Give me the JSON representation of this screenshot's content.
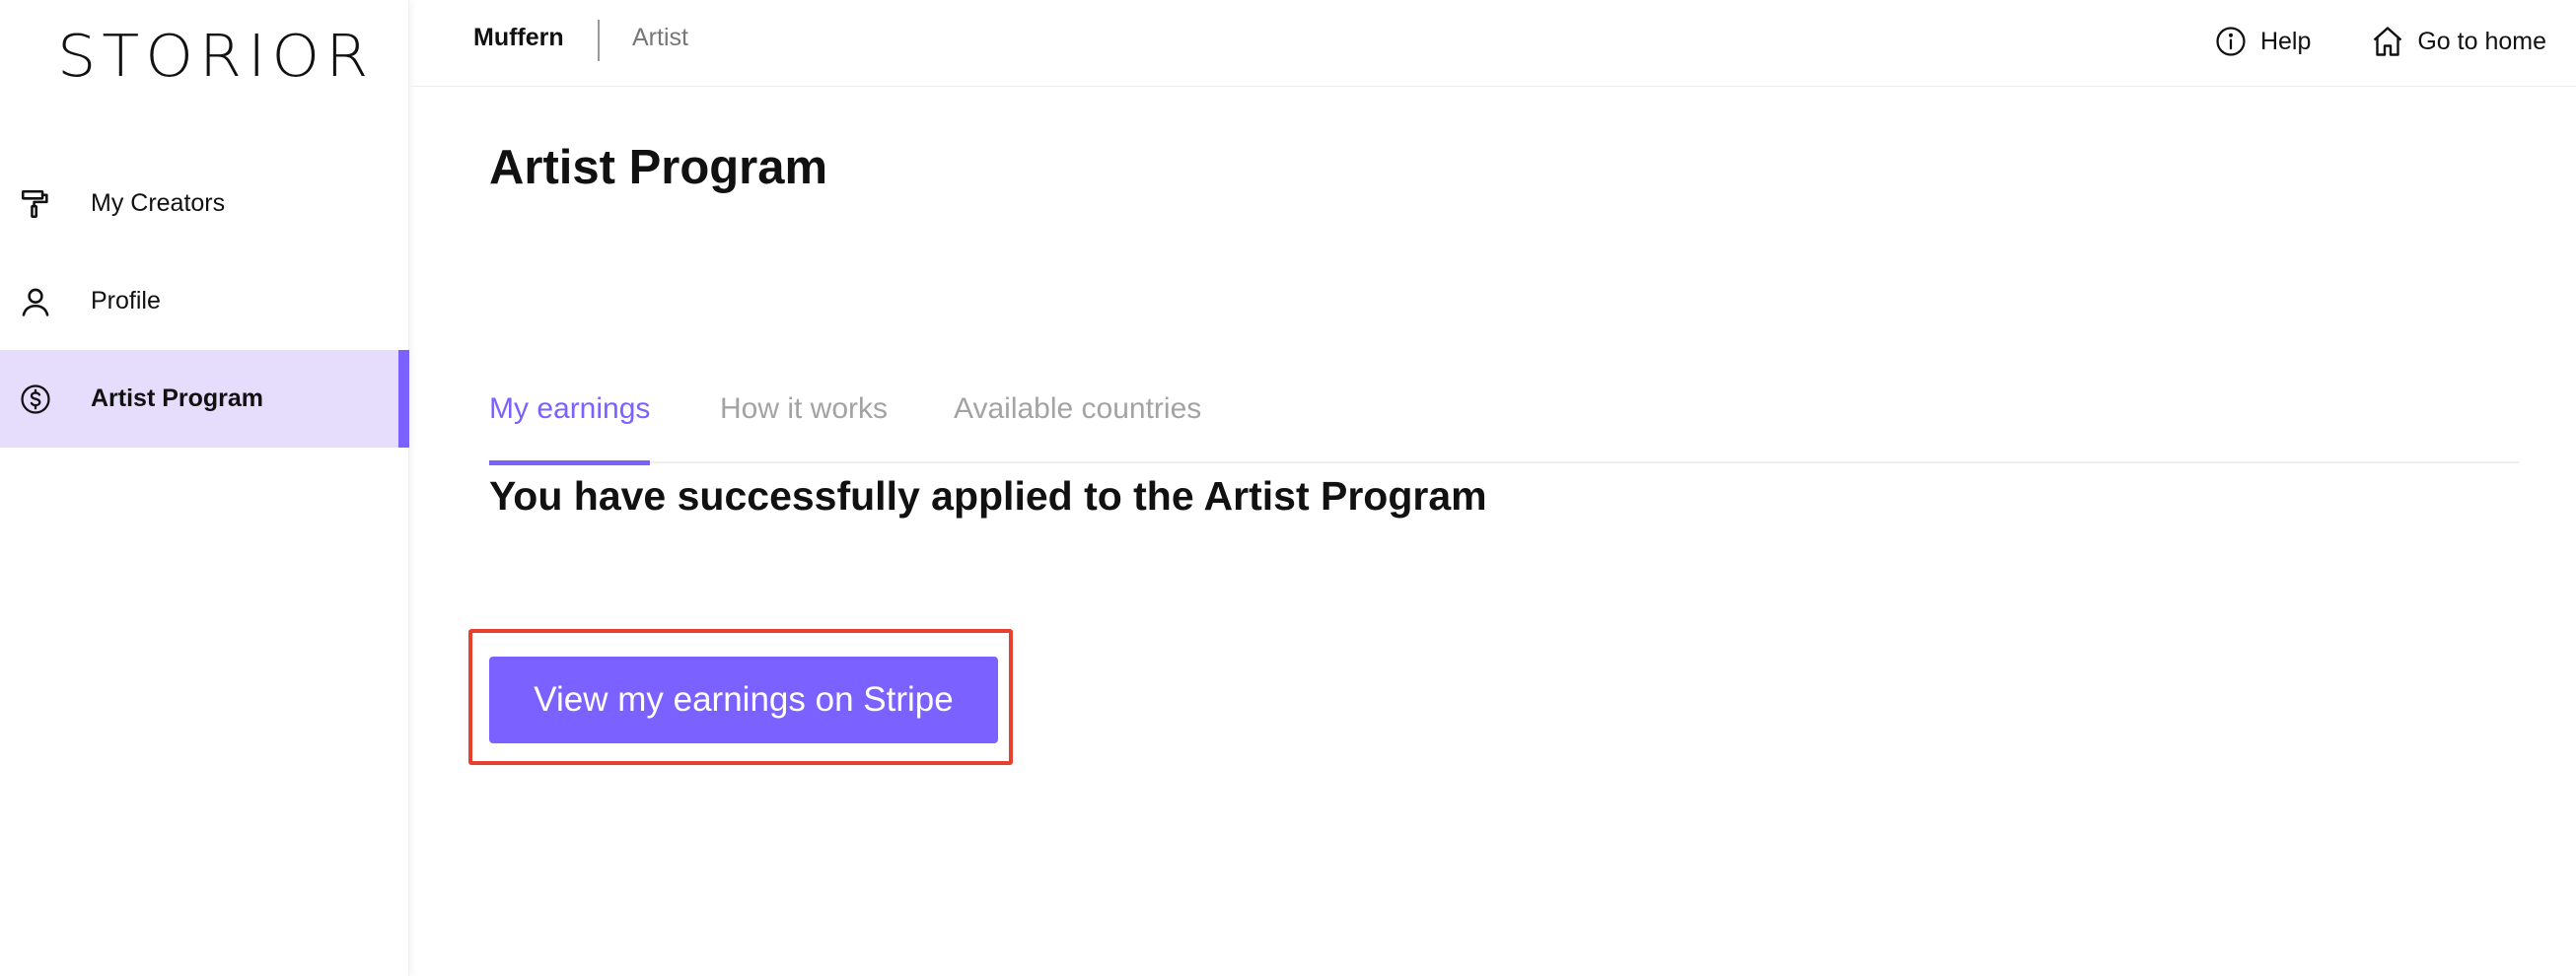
{
  "brand": {
    "logo_text": "STORIOR"
  },
  "sidebar": {
    "items": [
      {
        "label": "My Creators",
        "icon": "paint-roller-icon",
        "active": false
      },
      {
        "label": "Profile",
        "icon": "user-icon",
        "active": false
      },
      {
        "label": "Artist Program",
        "icon": "dollar-circle-icon",
        "active": true
      }
    ]
  },
  "header": {
    "primary": "Muffern",
    "secondary": "Artist",
    "help_label": "Help",
    "home_label": "Go to home"
  },
  "main": {
    "title": "Artist Program",
    "tabs": [
      {
        "label": "My earnings",
        "active": true
      },
      {
        "label": "How it works",
        "active": false
      },
      {
        "label": "Available countries",
        "active": false
      }
    ],
    "message": "You have successfully applied to the Artist Program",
    "cta_label": "View my earnings on Stripe"
  },
  "colors": {
    "accent": "#7b61ff",
    "active_bg": "#e6dcfb",
    "highlight_border": "#e8402f"
  }
}
